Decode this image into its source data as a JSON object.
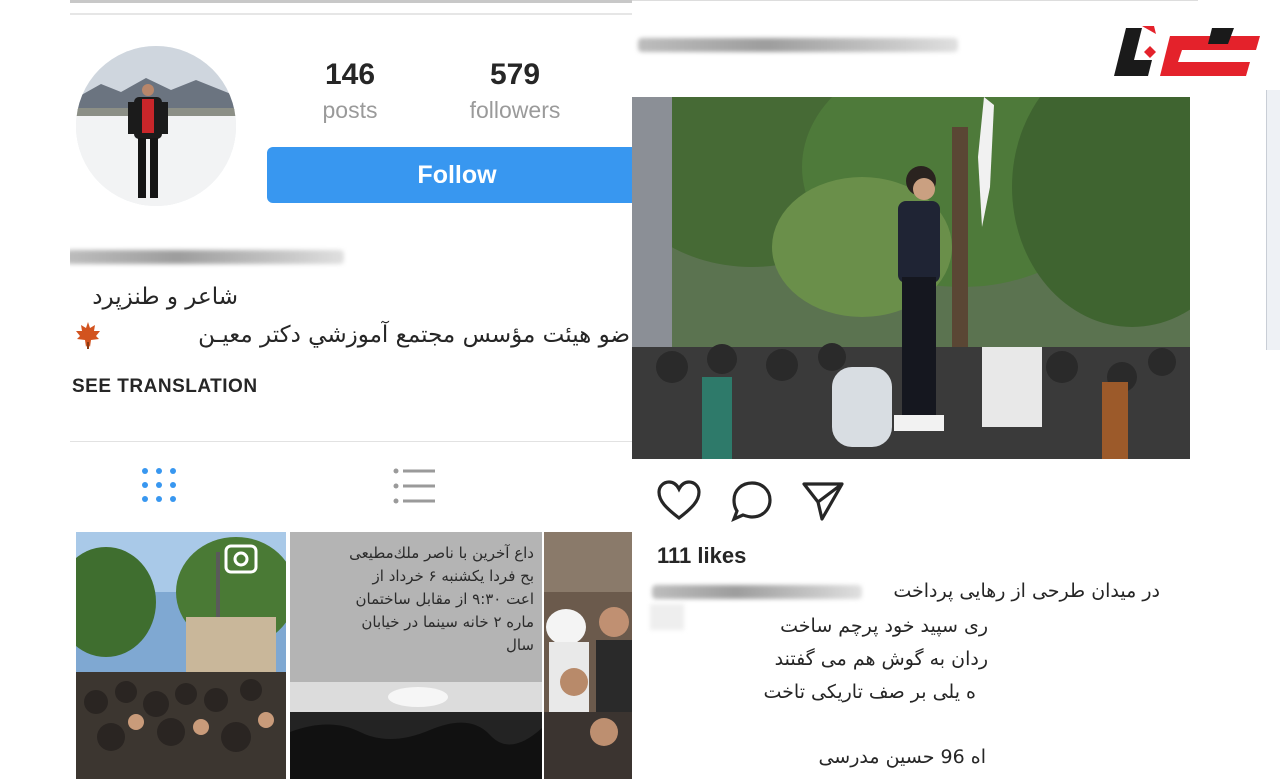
{
  "profile": {
    "stats": [
      {
        "value": "146",
        "label": "posts"
      },
      {
        "value": "579",
        "label": "followers"
      }
    ],
    "follow_label": "Follow",
    "bio_lines": [
      "شاعر و طنزپرد",
      "ضو هيئت مؤسس مجتمع آموزشي دكتر معيـن"
    ],
    "see_translation": "SEE TRANSLATION",
    "tabs": [
      {
        "name": "grid",
        "icon": "grid-icon",
        "active": true
      },
      {
        "name": "list",
        "icon": "list-icon",
        "active": false
      }
    ],
    "grid_text_post": [
      "داع آخرين با  ناصر ملك‌مطيعی",
      "بح فردا يكشنبه ۶ خرداد از",
      "اعت ۹:۳۰ از مقابل ساختمان",
      "ماره ۲ خانه سينما در خيابان",
      "سال"
    ]
  },
  "post": {
    "likes": "111 likes",
    "caption_lines": [
      "در ميدان طرحی از رهايی پرداخت",
      "ری سپيد خود پرچم ساخت",
      "ردان به گوش هم می گفتند",
      "ه يلی بر صف تاريكی تاخت"
    ],
    "signature": "اه 96 حسين مدرسی",
    "actions": [
      "heart-icon",
      "comment-icon",
      "share-icon"
    ]
  },
  "colors": {
    "follow_blue": "#3897f0",
    "grid_icon_blue": "#3897f0",
    "logo_red": "#e4222b",
    "logo_black": "#1a1a1a"
  }
}
